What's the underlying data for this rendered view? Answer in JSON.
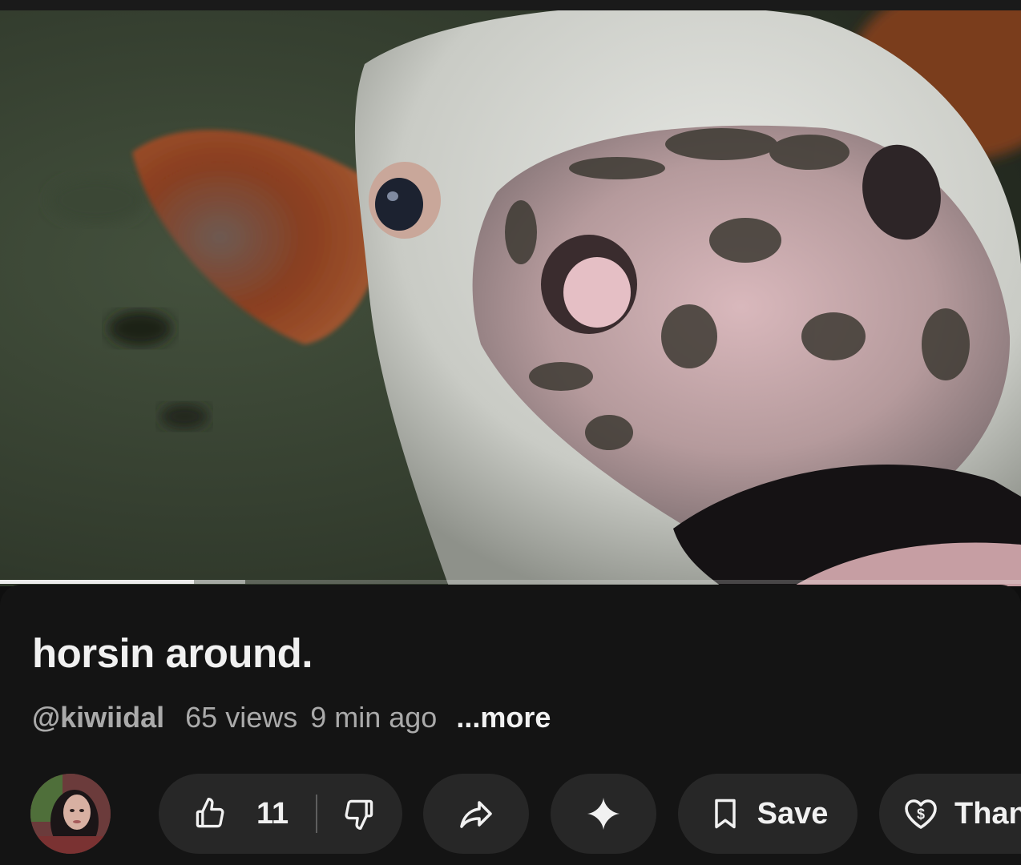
{
  "video": {
    "image": "close-up of a white and brown calf's muddy nose and mouth, looking up at the camera on a grassy field",
    "progress_percent": 19,
    "buffered_percent": 24
  },
  "info": {
    "title": "horsin around.",
    "channel": "@kiwiidal",
    "views": "65 views",
    "age": "9 min ago",
    "more_label": "...more"
  },
  "actions": {
    "avatar_icon": "channel-avatar",
    "like_icon": "thumbs-up-icon",
    "like_count": "11",
    "dislike_icon": "thumbs-down-icon",
    "share_icon": "share-arrow-icon",
    "ai_icon": "sparkle-icon",
    "save_icon": "bookmark-icon",
    "save_label": "Save",
    "thanks_icon": "heart-dollar-icon",
    "thanks_label": "Thanks"
  },
  "colors": {
    "background": "#0f0f0f",
    "panel": "#141414",
    "pill": "#272727",
    "text_primary": "#f1f1f1",
    "text_secondary": "#aaaaaa"
  }
}
